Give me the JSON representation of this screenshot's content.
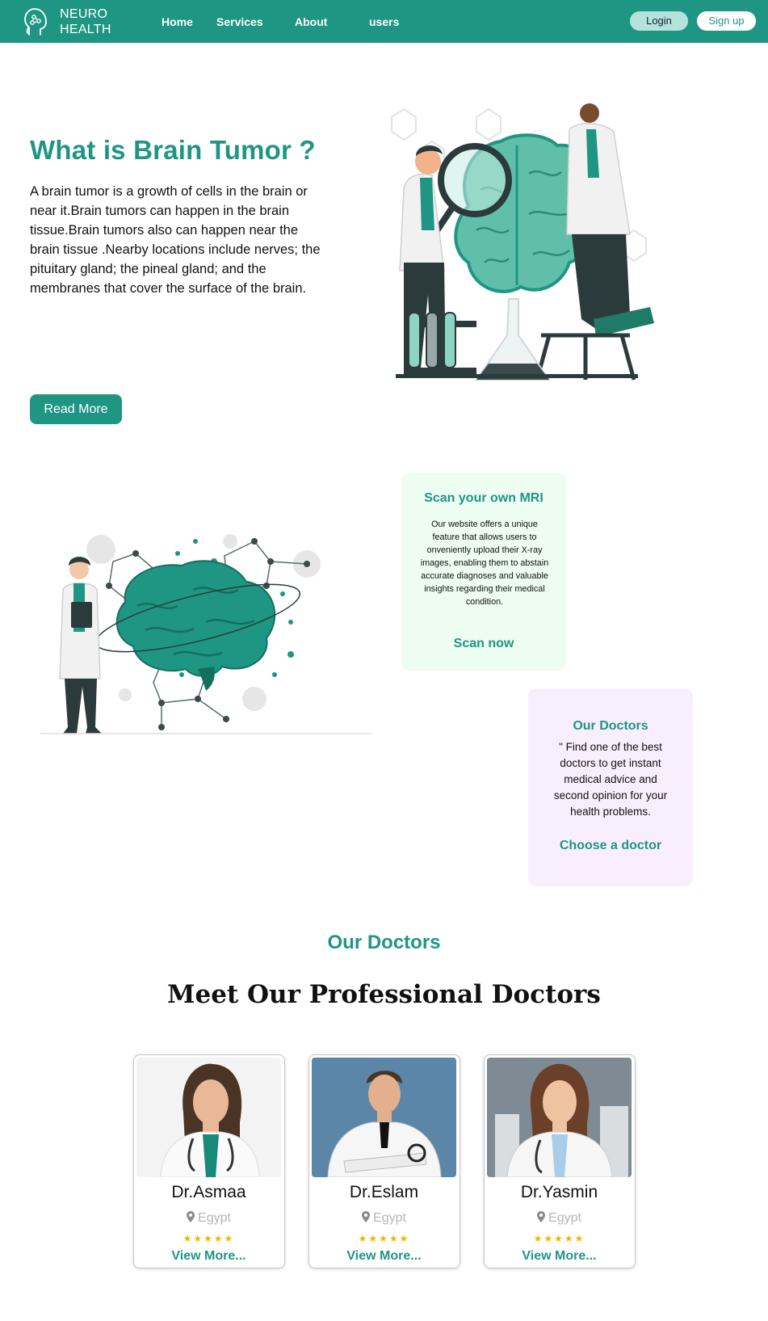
{
  "nav": {
    "brand_line1": "NEURO",
    "brand_line2": "HEALTH",
    "links": [
      "Home",
      "Services",
      "About",
      "users"
    ],
    "login_label": "Login",
    "signup_label": "Sign up"
  },
  "hero": {
    "title": "What is Brain Tumor ?",
    "text": "A brain tumor is a growth of cells in the brain or near it.Brain tumors can happen in the brain tissue.Brain tumors also can happen near the brain tissue .Nearby locations include nerves; the pituitary gland; the pineal gland; and the membranes that cover the surface of the brain.",
    "button_label": "Read More"
  },
  "scan_card": {
    "title": "Scan your own MRI",
    "text": "Our website offers a unique feature that allows users to onveniently upload their X-ray images, enabling them to  abstain accurate diagnoses and valuable insights regarding their medical condition.",
    "link_label": "Scan now"
  },
  "doctors_card": {
    "title": "Our Doctors",
    "text": "\" Find one of the best doctors to get instant medical advice and second opinion for your health problems.",
    "link_label": "Choose a doctor"
  },
  "doctors_section": {
    "label": "Our Doctors",
    "heading": "Meet Our Professional Doctors",
    "doctors": [
      {
        "name": "Dr.Asmaa",
        "location": "Egypt",
        "stars": "★★★★★",
        "link_label": "View More..."
      },
      {
        "name": "Dr.Eslam",
        "location": "Egypt",
        "stars": "★★★★★",
        "link_label": "View More..."
      },
      {
        "name": "Dr.Yasmin",
        "location": "Egypt",
        "stars": "★★★★★",
        "link_label": "View More..."
      }
    ]
  },
  "colors": {
    "primary": "#1f9584",
    "scan_card_bg": "#edfdf2",
    "doctors_card_bg": "#f9eefe",
    "star": "#f4b400"
  },
  "icons": {
    "logo": "head-brain-icon",
    "location": "map-pin-icon",
    "rating": "star-icon"
  }
}
